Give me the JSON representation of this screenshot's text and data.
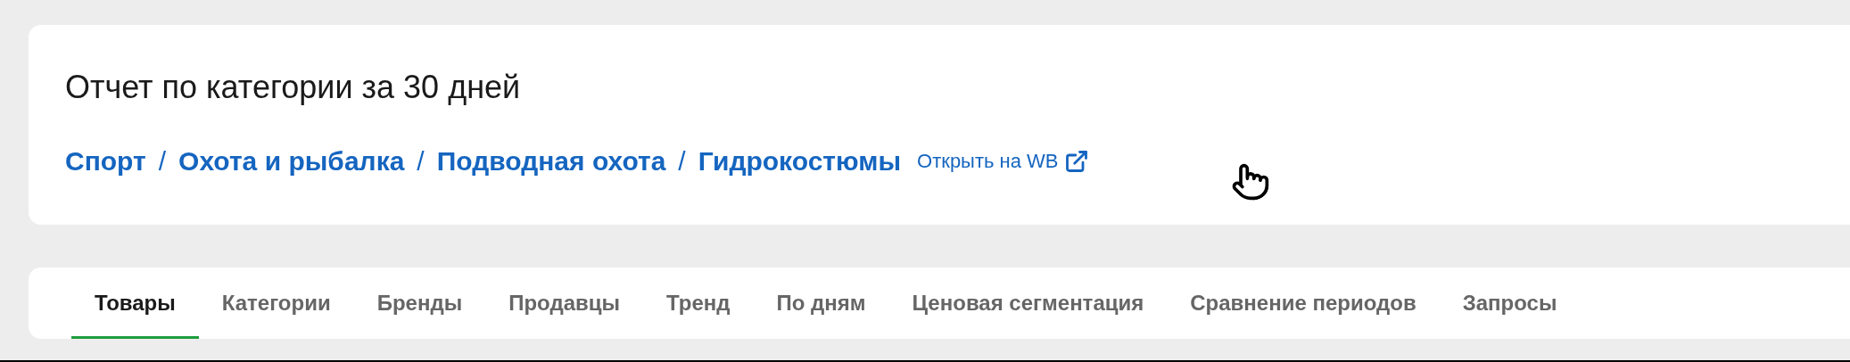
{
  "header": {
    "title": "Отчет по категории за 30 дней",
    "breadcrumbs": [
      "Спорт",
      "Охота и рыбалка",
      "Подводная охота",
      "Гидрокостюмы"
    ],
    "separator": "/",
    "external_link": "Открыть на WB"
  },
  "tabs": [
    {
      "label": "Товары",
      "selected": true
    },
    {
      "label": "Категории",
      "selected": false
    },
    {
      "label": "Бренды",
      "selected": false
    },
    {
      "label": "Продавцы",
      "selected": false
    },
    {
      "label": "Тренд",
      "selected": false
    },
    {
      "label": "По дням",
      "selected": false
    },
    {
      "label": "Ценовая сегментация",
      "selected": false
    },
    {
      "label": "Сравнение периодов",
      "selected": false
    },
    {
      "label": "Запросы",
      "selected": false
    }
  ]
}
